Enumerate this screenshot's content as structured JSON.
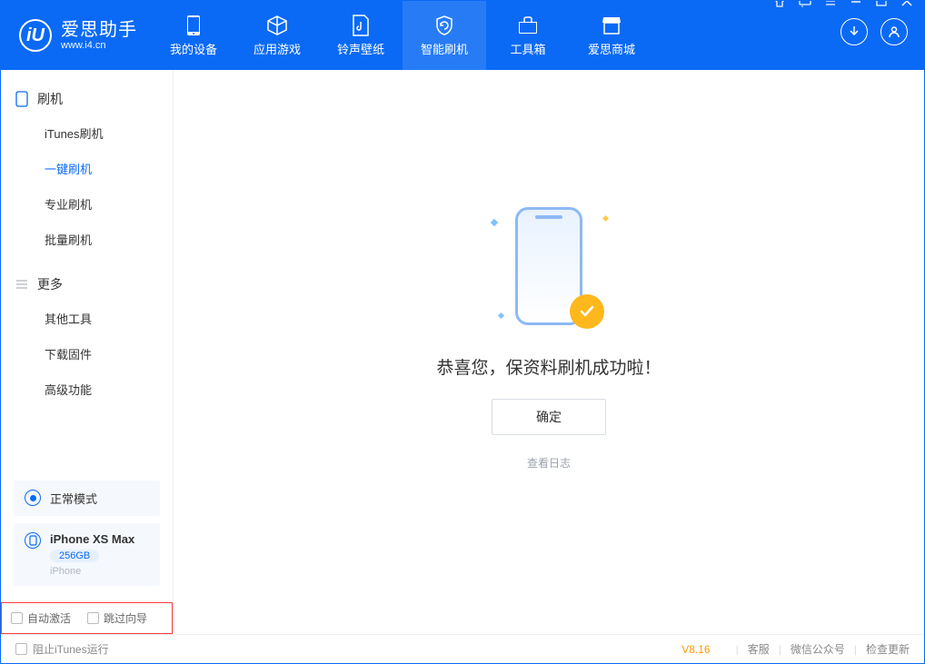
{
  "app": {
    "title": "爱思助手",
    "subtitle": "www.i4.cn",
    "logo_letter": "iU"
  },
  "nav": {
    "items": [
      {
        "label": "我的设备"
      },
      {
        "label": "应用游戏"
      },
      {
        "label": "铃声壁纸"
      },
      {
        "label": "智能刷机"
      },
      {
        "label": "工具箱"
      },
      {
        "label": "爱思商城"
      }
    ],
    "active_index": 3
  },
  "sidebar": {
    "group1": {
      "header": "刷机",
      "items": [
        "iTunes刷机",
        "一键刷机",
        "专业刷机",
        "批量刷机"
      ],
      "active_index": 1
    },
    "group2": {
      "header": "更多",
      "items": [
        "其他工具",
        "下载固件",
        "高级功能"
      ]
    }
  },
  "device": {
    "mode_label": "正常模式",
    "name": "iPhone XS Max",
    "storage": "256GB",
    "type": "iPhone"
  },
  "options": {
    "auto_activate": "自动激活",
    "skip_guide": "跳过向导"
  },
  "main": {
    "success_text": "恭喜您，保资料刷机成功啦！",
    "ok_button": "确定",
    "view_log": "查看日志"
  },
  "statusbar": {
    "block_itunes": "阻止iTunes运行",
    "version": "V8.16",
    "links": [
      "客服",
      "微信公众号",
      "检查更新"
    ]
  }
}
